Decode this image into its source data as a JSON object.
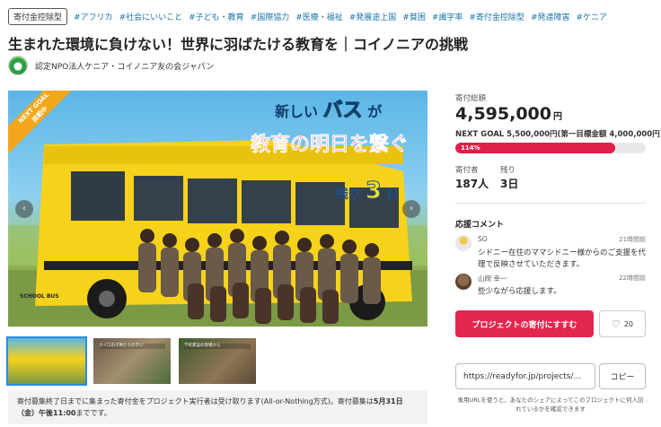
{
  "tags": {
    "badge": "寄付金控除型",
    "items": [
      "#アフリカ",
      "#社会にいいこと",
      "#子ども・教育",
      "#国際協力",
      "#医療・福祉",
      "#発展途上国",
      "#貧困",
      "#識字率",
      "#寄付金控除型",
      "#発達障害",
      "#ケニア"
    ]
  },
  "title": "生まれた環境に負けない！世界に羽ばたける教育を｜コイノニアの挑戦",
  "org": {
    "name": "認定NPO法人ケニア・コイノニア友の会ジャパン"
  },
  "hero": {
    "ribbon_line1": "NEXT GOAL",
    "ribbon_line2": "挑戦中",
    "banner_pre": "新しい",
    "banner_big": "バス",
    "banner_post": "が",
    "banner_line2": "教育の明日を繋ぐ",
    "remaining_pre": "残り",
    "remaining_num": "3",
    "remaining_unit": "日",
    "bus_sign": "SCHOOL BUS",
    "prev_label": "‹",
    "next_label": "›"
  },
  "thumbnails": [
    {
      "caption": "",
      "active": true
    },
    {
      "caption": "カイロの子供たちの学び",
      "active": false
    },
    {
      "caption": "学校建設の現場から",
      "active": false
    }
  ],
  "notice": {
    "text": "寄付募集終了日までに集まった寄付金をプロジェクト実行者は受け取ります(All-or-Nothing方式)。寄付募集は",
    "deadline": "5月31日（金）午後11:00",
    "suffix": "までです。"
  },
  "stats": {
    "total_label": "寄付総額",
    "total_amount": "4,595,000",
    "yen": "円",
    "next_goal": "NEXT GOAL 5,500,000円(第一目標金額 4,000,000円)",
    "percent_label": "114%",
    "progress_main": 1.0,
    "progress_next": 0.84,
    "supporters_label": "寄付者",
    "supporters_value": "187人",
    "remaining_label": "残り",
    "remaining_value": "3日"
  },
  "comments": {
    "heading": "応援コメント",
    "items": [
      {
        "name": "SO",
        "time": "21時間前",
        "body": "シドニー在住のママシドニー様からのご支援を代理で反映させていただきます。"
      },
      {
        "name": "山岡 幸一",
        "time": "22時間前",
        "body": "些少ながら応援します。"
      }
    ]
  },
  "actions": {
    "support_label": "プロジェクトの寄付にすすむ",
    "favorite_count": "20",
    "url_value": "https://readyfor.jp/projects/...",
    "copy_label": "コピー",
    "share_note": "専用URLを使うと、あなたのシェアによってこのプロジェクトに何人訪れているかを確認できます"
  },
  "colors": {
    "accent": "#e2264d",
    "progress_next": "#f29a2e",
    "tag_link": "#1a73a8"
  }
}
